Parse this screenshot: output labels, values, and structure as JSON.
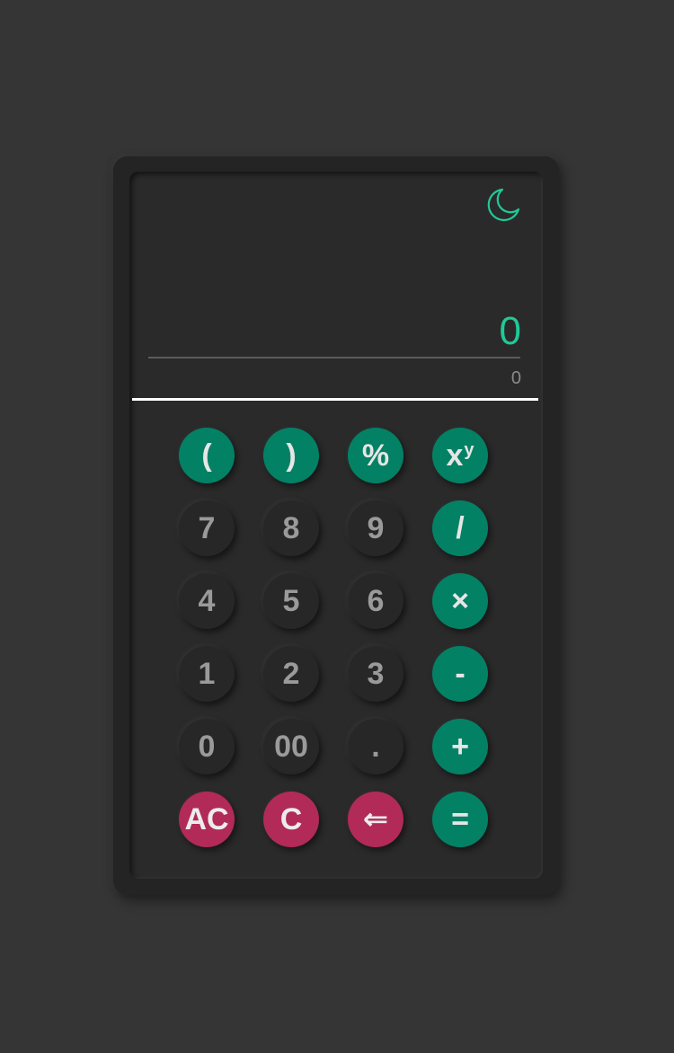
{
  "display": {
    "expression": "0",
    "result": "0"
  },
  "theme_toggle": {
    "icon": "moon-icon"
  },
  "colors": {
    "background": "#353535",
    "accent": "#20c997",
    "operator_button": "#038165",
    "clear_button": "#b12a58",
    "number_button": "#272727"
  },
  "keys": {
    "row1": [
      "(",
      ")",
      "%",
      "x"
    ],
    "power_superscript": "y",
    "row2": [
      "7",
      "8",
      "9",
      "/"
    ],
    "row3": [
      "4",
      "5",
      "6",
      "×"
    ],
    "row4": [
      "1",
      "2",
      "3",
      "-"
    ],
    "row5": [
      "0",
      "00",
      ".",
      "+"
    ],
    "row6": [
      "AC",
      "C",
      "⇐",
      "="
    ]
  }
}
